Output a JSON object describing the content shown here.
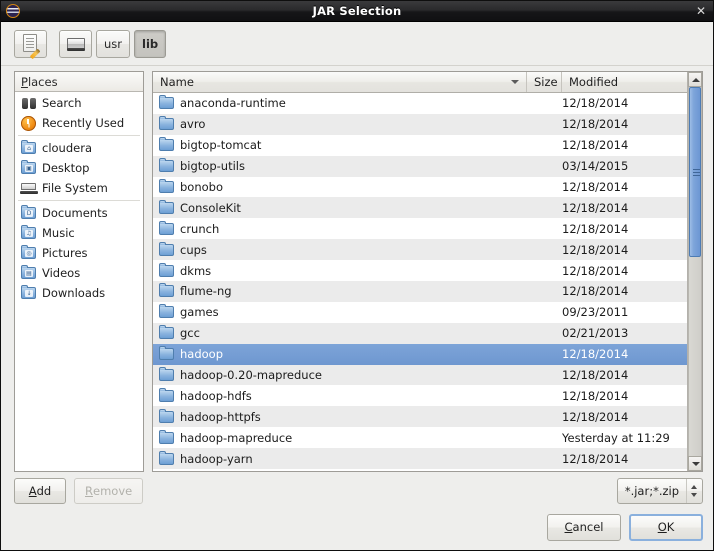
{
  "window": {
    "title": "JAR Selection",
    "icon": "java-duke-icon",
    "close_label": "✕"
  },
  "pathbar": {
    "type_path_button": "type-a-file-name-icon",
    "buttons": [
      {
        "label": "",
        "icon": "drive-harddisk-icon",
        "active": false
      },
      {
        "label": "usr",
        "icon": "",
        "active": false
      },
      {
        "label": "lib",
        "icon": "",
        "active": true
      }
    ]
  },
  "sidebar": {
    "header": "Places",
    "header_mnemonic": "P",
    "items": [
      {
        "label": "Search",
        "icon": "binoculars-icon",
        "group": 0
      },
      {
        "label": "Recently Used",
        "icon": "recent-clock-icon",
        "group": 0
      },
      {
        "label": "cloudera",
        "icon": "home-folder-icon",
        "group": 1,
        "glyph": "⌂"
      },
      {
        "label": "Desktop",
        "icon": "desktop-folder-icon",
        "group": 1,
        "glyph": "▣"
      },
      {
        "label": "File System",
        "icon": "filesystem-drive-icon",
        "group": 1
      },
      {
        "label": "Documents",
        "icon": "documents-folder-icon",
        "group": 2,
        "glyph": "D"
      },
      {
        "label": "Music",
        "icon": "music-folder-icon",
        "group": 2,
        "glyph": "♫"
      },
      {
        "label": "Pictures",
        "icon": "pictures-folder-icon",
        "group": 2,
        "glyph": "◎"
      },
      {
        "label": "Videos",
        "icon": "videos-folder-icon",
        "group": 2,
        "glyph": "▤"
      },
      {
        "label": "Downloads",
        "icon": "downloads-folder-icon",
        "group": 2,
        "glyph": "↓"
      }
    ]
  },
  "filelist": {
    "columns": [
      {
        "key": "name",
        "label": "Name",
        "sorted": true
      },
      {
        "key": "size",
        "label": "Size",
        "sorted": false
      },
      {
        "key": "modified",
        "label": "Modified",
        "sorted": false
      }
    ],
    "rows": [
      {
        "name": "anaconda-runtime",
        "size": "",
        "modified": "12/18/2014",
        "selected": false
      },
      {
        "name": "avro",
        "size": "",
        "modified": "12/18/2014",
        "selected": false
      },
      {
        "name": "bigtop-tomcat",
        "size": "",
        "modified": "12/18/2014",
        "selected": false
      },
      {
        "name": "bigtop-utils",
        "size": "",
        "modified": "03/14/2015",
        "selected": false
      },
      {
        "name": "bonobo",
        "size": "",
        "modified": "12/18/2014",
        "selected": false
      },
      {
        "name": "ConsoleKit",
        "size": "",
        "modified": "12/18/2014",
        "selected": false
      },
      {
        "name": "crunch",
        "size": "",
        "modified": "12/18/2014",
        "selected": false
      },
      {
        "name": "cups",
        "size": "",
        "modified": "12/18/2014",
        "selected": false
      },
      {
        "name": "dkms",
        "size": "",
        "modified": "12/18/2014",
        "selected": false
      },
      {
        "name": "flume-ng",
        "size": "",
        "modified": "12/18/2014",
        "selected": false
      },
      {
        "name": "games",
        "size": "",
        "modified": "09/23/2011",
        "selected": false
      },
      {
        "name": "gcc",
        "size": "",
        "modified": "02/21/2013",
        "selected": false
      },
      {
        "name": "hadoop",
        "size": "",
        "modified": "12/18/2014",
        "selected": true
      },
      {
        "name": "hadoop-0.20-mapreduce",
        "size": "",
        "modified": "12/18/2014",
        "selected": false
      },
      {
        "name": "hadoop-hdfs",
        "size": "",
        "modified": "12/18/2014",
        "selected": false
      },
      {
        "name": "hadoop-httpfs",
        "size": "",
        "modified": "12/18/2014",
        "selected": false
      },
      {
        "name": "hadoop-mapreduce",
        "size": "",
        "modified": "Yesterday at 11:29",
        "selected": false
      },
      {
        "name": "hadoop-yarn",
        "size": "",
        "modified": "12/18/2014",
        "selected": false
      }
    ],
    "scrollbar": {
      "thumb_position_pct": 0,
      "thumb_size_pct": 46
    }
  },
  "bottombar": {
    "add_label": "Add",
    "add_mnemonic": "A",
    "remove_label": "Remove",
    "remove_mnemonic": "R",
    "remove_disabled": true,
    "filter_value": "*.jar;*.zip"
  },
  "actions": {
    "cancel_label": "Cancel",
    "cancel_mnemonic": "C",
    "ok_label": "OK",
    "ok_mnemonic": "O",
    "ok_focused": true
  },
  "colors": {
    "selection": "#6e97d0",
    "titlebar": "#161618",
    "dialog_bg": "#eeeeec",
    "row_alt": "#ebebeb"
  }
}
